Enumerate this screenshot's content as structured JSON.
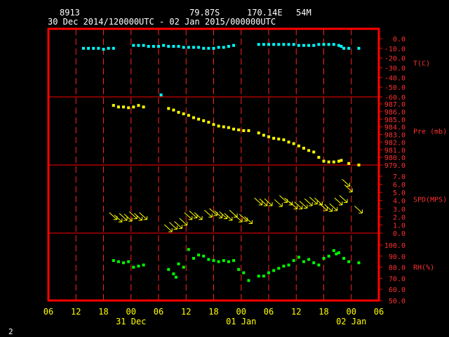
{
  "header": {
    "station": "8913",
    "lat": "79.87S",
    "lon": "170.14E",
    "elevation": "54M",
    "period": "30 Dec 2014/120000UTC - 02 Jan 2015/000000UTC"
  },
  "footer_mark": "2",
  "colors": {
    "background": "#000000",
    "frame": "#ff0000",
    "grid": "#ff2020",
    "text": "#ffffff",
    "axis_text": "#ffff00",
    "panel_label": "#ff3030",
    "temperature": "#00ffff",
    "pressure": "#ffff00",
    "wind": "#ffff00",
    "humidity": "#00ff00"
  },
  "chart_data": {
    "type": "scatter",
    "x_unit": "hours from 30 Dec 2014 06 UTC",
    "x_range": [
      0,
      66
    ],
    "x_tick_labels": [
      "06",
      "12",
      "18",
      "00",
      "06",
      "12",
      "18",
      "00",
      "06",
      "12",
      "18",
      "00",
      "06"
    ],
    "day_labels": [
      "31 Dec",
      "01 Jan",
      "02 Jan"
    ],
    "grid": true,
    "panels": [
      {
        "id": "temperature",
        "label": "T(C)",
        "ylim": [
          -60,
          0
        ],
        "ticks": [
          "0.0",
          "-10.0",
          "-20.0",
          "-30.0",
          "-40.0",
          "-50.0",
          "-60.0"
        ],
        "series": [
          {
            "marker": "square",
            "points": [
              [
                7,
                -10
              ],
              [
                8,
                -10
              ],
              [
                9,
                -10
              ],
              [
                10,
                -10
              ],
              [
                11,
                -11
              ],
              [
                12,
                -10
              ],
              [
                13,
                -10
              ],
              [
                17,
                -7
              ],
              [
                18,
                -7
              ],
              [
                19,
                -7
              ],
              [
                20,
                -8
              ],
              [
                21,
                -8
              ],
              [
                22,
                -8
              ],
              [
                22.5,
                -58
              ],
              [
                23,
                -7
              ],
              [
                24,
                -8
              ],
              [
                25,
                -8
              ],
              [
                26,
                -8
              ],
              [
                27,
                -9
              ],
              [
                28,
                -9
              ],
              [
                29,
                -9
              ],
              [
                30,
                -9
              ],
              [
                31,
                -10
              ],
              [
                32,
                -10
              ],
              [
                33,
                -10
              ],
              [
                34,
                -9
              ],
              [
                35,
                -9
              ],
              [
                36,
                -8
              ],
              [
                37,
                -7
              ],
              [
                42,
                -6
              ],
              [
                43,
                -6
              ],
              [
                44,
                -6
              ],
              [
                45,
                -6
              ],
              [
                46,
                -6
              ],
              [
                47,
                -6
              ],
              [
                48,
                -6
              ],
              [
                49,
                -6
              ],
              [
                50,
                -7
              ],
              [
                51,
                -7
              ],
              [
                52,
                -7
              ],
              [
                53,
                -7
              ],
              [
                54,
                -6
              ],
              [
                55,
                -6
              ],
              [
                56,
                -6
              ],
              [
                57,
                -6
              ],
              [
                58,
                -7
              ],
              [
                58.5,
                -8
              ],
              [
                59,
                -10
              ],
              [
                60,
                -10
              ],
              [
                62,
                -10
              ]
            ]
          }
        ]
      },
      {
        "id": "pressure",
        "label": "Pre (mb)",
        "ylim": [
          979,
          987
        ],
        "ticks": [
          "987.0",
          "986.0",
          "985.0",
          "984.0",
          "983.0",
          "982.0",
          "981.0",
          "980.0",
          "979.0"
        ],
        "series": [
          {
            "marker": "square",
            "points": [
              [
                13,
                986.8
              ],
              [
                14,
                986.6
              ],
              [
                15,
                986.6
              ],
              [
                16,
                986.5
              ],
              [
                17,
                986.6
              ],
              [
                18,
                986.8
              ],
              [
                19,
                986.6
              ],
              [
                24,
                986.4
              ],
              [
                25,
                986.2
              ],
              [
                26,
                985.9
              ],
              [
                27,
                985.7
              ],
              [
                28,
                985.5
              ],
              [
                29,
                985.2
              ],
              [
                30,
                985.0
              ],
              [
                31,
                984.8
              ],
              [
                32,
                984.6
              ],
              [
                33,
                984.3
              ],
              [
                34,
                984.1
              ],
              [
                35,
                984.0
              ],
              [
                36,
                983.9
              ],
              [
                37,
                983.7
              ],
              [
                38,
                983.6
              ],
              [
                39,
                983.5
              ],
              [
                40,
                983.5
              ],
              [
                42,
                983.2
              ],
              [
                43,
                982.9
              ],
              [
                44,
                982.7
              ],
              [
                45,
                982.5
              ],
              [
                46,
                982.4
              ],
              [
                47,
                982.3
              ],
              [
                48,
                982.0
              ],
              [
                49,
                981.8
              ],
              [
                50,
                981.5
              ],
              [
                51,
                981.2
              ],
              [
                52,
                980.9
              ],
              [
                53,
                980.7
              ],
              [
                54,
                980.0
              ],
              [
                55,
                979.5
              ],
              [
                56,
                979.4
              ],
              [
                57,
                979.4
              ],
              [
                58,
                979.5
              ],
              [
                58.5,
                979.6
              ],
              [
                60,
                979.2
              ],
              [
                62,
                979.0
              ]
            ]
          }
        ]
      },
      {
        "id": "wind_speed",
        "label": "SPD(MPS)",
        "ylim": [
          0,
          7
        ],
        "ticks": [
          "7.0",
          "6.0",
          "5.0",
          "4.0",
          "3.0",
          "2.0",
          "1.0",
          "0.0"
        ],
        "series": [
          {
            "marker": "wind-arrow",
            "points": [
              [
                13,
                2.1
              ],
              [
                14,
                1.8
              ],
              [
                15,
                2.0
              ],
              [
                16,
                1.9
              ],
              [
                17,
                2.2
              ],
              [
                18,
                2.0
              ],
              [
                19,
                2.1
              ],
              [
                24,
                0.6
              ],
              [
                25,
                0.9
              ],
              [
                26,
                1.0
              ],
              [
                27,
                1.4
              ],
              [
                28,
                2.1
              ],
              [
                29,
                2.3
              ],
              [
                30,
                2.1
              ],
              [
                32,
                2.4
              ],
              [
                33,
                2.6
              ],
              [
                34,
                2.3
              ],
              [
                35,
                2.2
              ],
              [
                36,
                2.0
              ],
              [
                37,
                2.4
              ],
              [
                38,
                1.8
              ],
              [
                39,
                1.9
              ],
              [
                40,
                1.6
              ],
              [
                42,
                3.9
              ],
              [
                43,
                3.8
              ],
              [
                44,
                3.8
              ],
              [
                46,
                3.7
              ],
              [
                47,
                4.2
              ],
              [
                48,
                3.9
              ],
              [
                49,
                3.4
              ],
              [
                50,
                3.4
              ],
              [
                51,
                3.5
              ],
              [
                52,
                3.8
              ],
              [
                53,
                4.0
              ],
              [
                54,
                3.9
              ],
              [
                55,
                3.2
              ],
              [
                56,
                3.1
              ],
              [
                57,
                3.2
              ],
              [
                58,
                3.9
              ],
              [
                59,
                4.2
              ],
              [
                59.5,
                6.2
              ],
              [
                60,
                5.5
              ],
              [
                62,
                2.9
              ]
            ]
          }
        ]
      },
      {
        "id": "humidity",
        "label": "RH(%)",
        "ylim": [
          50,
          100
        ],
        "ticks": [
          "100.0",
          "90.0",
          "80.0",
          "70.0",
          "60.0",
          "50.0"
        ],
        "series": [
          {
            "marker": "square",
            "points": [
              [
                13,
                86
              ],
              [
                14,
                85
              ],
              [
                15,
                84
              ],
              [
                16,
                85
              ],
              [
                17,
                80
              ],
              [
                18,
                81
              ],
              [
                19,
                82
              ],
              [
                24,
                78
              ],
              [
                25,
                74
              ],
              [
                25.5,
                71
              ],
              [
                26,
                83
              ],
              [
                27,
                80
              ],
              [
                28,
                96
              ],
              [
                29,
                88
              ],
              [
                30,
                91
              ],
              [
                31,
                90
              ],
              [
                32,
                87
              ],
              [
                33,
                86
              ],
              [
                34,
                85
              ],
              [
                35,
                86
              ],
              [
                36,
                85
              ],
              [
                37,
                86
              ],
              [
                38,
                78
              ],
              [
                39,
                75
              ],
              [
                40,
                68
              ],
              [
                42,
                72
              ],
              [
                43,
                72
              ],
              [
                44,
                75
              ],
              [
                45,
                77
              ],
              [
                46,
                79
              ],
              [
                47,
                81
              ],
              [
                48,
                82
              ],
              [
                49,
                86
              ],
              [
                50,
                89
              ],
              [
                51,
                85
              ],
              [
                52,
                87
              ],
              [
                53,
                84
              ],
              [
                54,
                82
              ],
              [
                55,
                88
              ],
              [
                56,
                90
              ],
              [
                57,
                95
              ],
              [
                57.5,
                92
              ],
              [
                58,
                93
              ],
              [
                59,
                88
              ],
              [
                60,
                85
              ],
              [
                62,
                84
              ]
            ]
          }
        ]
      }
    ]
  }
}
